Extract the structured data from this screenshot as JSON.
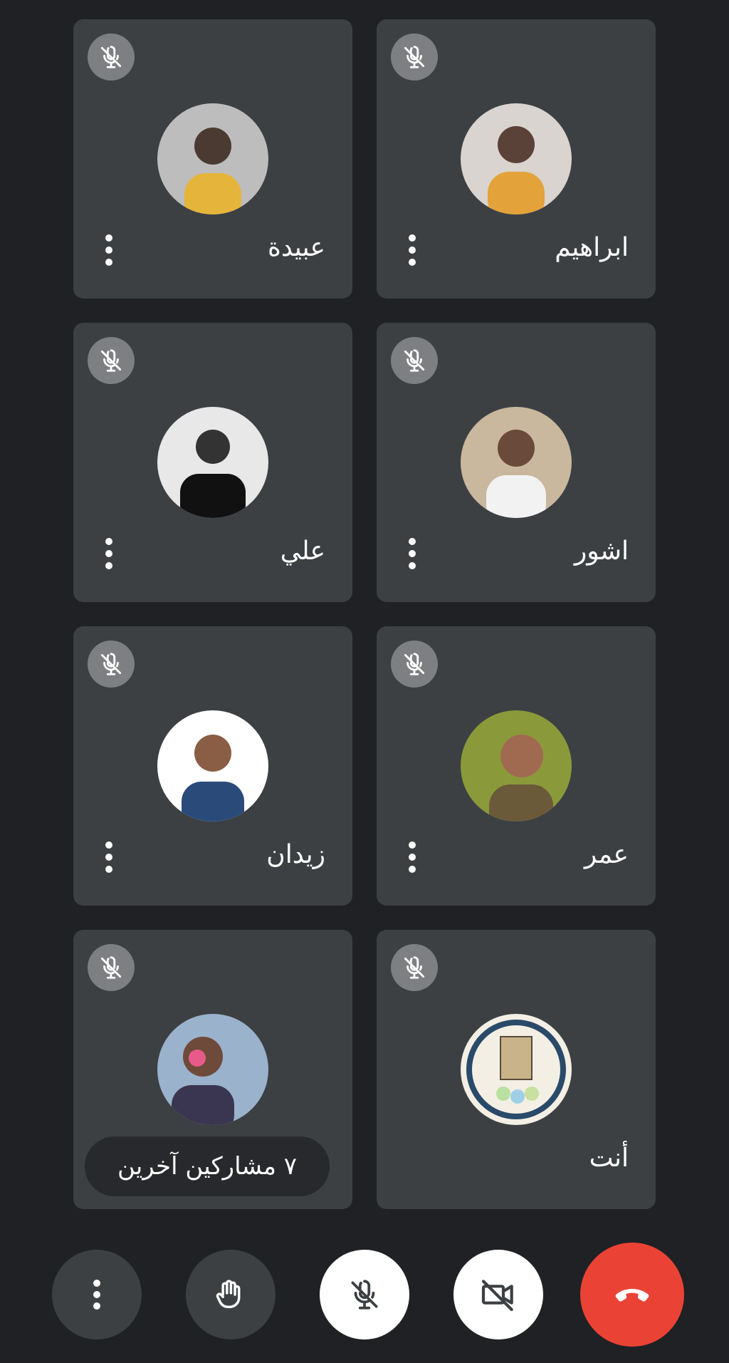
{
  "participants": [
    {
      "name": "ابراهيم",
      "muted": true,
      "avatar": "photo-man-yellow-shirt"
    },
    {
      "name": "عبيدة",
      "muted": true,
      "avatar": "photo-man-sunglasses"
    },
    {
      "name": "اشور",
      "muted": true,
      "avatar": "photo-man-white-jacket"
    },
    {
      "name": "علي",
      "muted": true,
      "avatar": "photo-man-tuxedo-bw"
    },
    {
      "name": "عمر",
      "muted": true,
      "avatar": "photo-man-outdoor"
    },
    {
      "name": "زيدان",
      "muted": true,
      "avatar": "photo-man-suit"
    },
    {
      "name": "أنت",
      "muted": true,
      "avatar": "university-logo"
    },
    {
      "name": "",
      "muted": true,
      "avatar": "photo-woman-flower"
    }
  ],
  "others_label": "٧ مشاركين آخرين",
  "controls": {
    "more": "more-options-icon",
    "raise_hand": "raise-hand-icon",
    "mic": "mic-off-icon",
    "camera": "camera-off-icon",
    "end_call": "end-call-icon"
  },
  "colors": {
    "background": "#202124",
    "tile": "#3c4043",
    "end_call": "#ea4335",
    "mic_badge": "#7d7f83"
  }
}
